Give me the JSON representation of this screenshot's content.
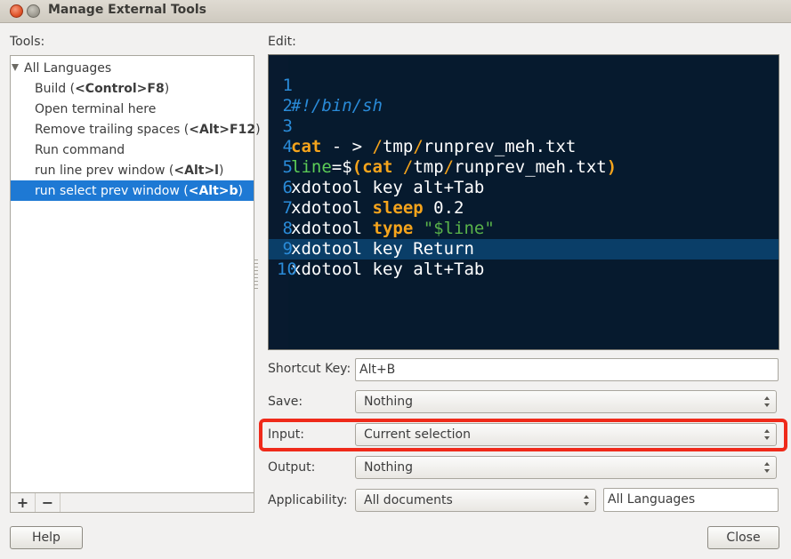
{
  "window": {
    "title": "Manage External Tools"
  },
  "tools_label": "Tools:",
  "edit_label": "Edit:",
  "tree": {
    "root": "All Languages",
    "items": [
      {
        "name": "Build (",
        "key": "<Control>F8",
        "close": ")"
      },
      {
        "name": "Open terminal here",
        "key": "",
        "close": ""
      },
      {
        "name": "Remove trailing spaces (",
        "key": "<Alt>F12",
        "close": ")"
      },
      {
        "name": "Run command",
        "key": "",
        "close": ""
      },
      {
        "name": "run line prev window (",
        "key": "<Alt>l",
        "close": ")"
      },
      {
        "name": "run select prev window (",
        "key": "<Alt>b",
        "close": ")"
      }
    ],
    "add_symbol": "+",
    "remove_symbol": "−"
  },
  "editor": {
    "line_numbers": [
      "1",
      "2",
      "3",
      "4",
      "5",
      "6",
      "7",
      "8",
      "9",
      "10"
    ],
    "l1_comment": "#!/bin/sh",
    "l3_cat": "cat",
    "l3_mid": " - > ",
    "l3_slash1": "/",
    "l3_tmp": "tmp",
    "l3_slash2": "/",
    "l3_file": "runprev_meh.txt",
    "l4_var": "line",
    "l4_eq": "=$",
    "l4_paren": "(",
    "l4_cat": "cat",
    "l4_sp": " ",
    "l4_slash1": "/",
    "l4_tmp": "tmp",
    "l4_slash2": "/",
    "l4_file": "runprev_meh.txt",
    "l4_close": ")",
    "l5": "xdotool key alt+Tab",
    "l6_cmd": "xdotool ",
    "l6_kw": "sleep",
    "l6_rest": " 0.2",
    "l7_cmd": "xdotool ",
    "l7_kw": "type",
    "l7_sp": " ",
    "l7_str": "\"$line\"",
    "l8": "xdotool key Return",
    "l9": "xdotool key alt+Tab"
  },
  "fields": {
    "shortcut_label": "Shortcut Key:",
    "shortcut_value": "Alt+B",
    "save_label": "Save:",
    "save_value": "Nothing",
    "input_label": "Input:",
    "input_value": "Current selection",
    "output_label": "Output:",
    "output_value": "Nothing",
    "applicability_label": "Applicability:",
    "applicability_value": "All documents",
    "language_value": "All Languages"
  },
  "buttons": {
    "help": "Help",
    "close": "Close"
  },
  "colors": {
    "selection": "#1e79d4",
    "editor_bg": "#061a2e",
    "highlight": "#ef2a1a"
  }
}
